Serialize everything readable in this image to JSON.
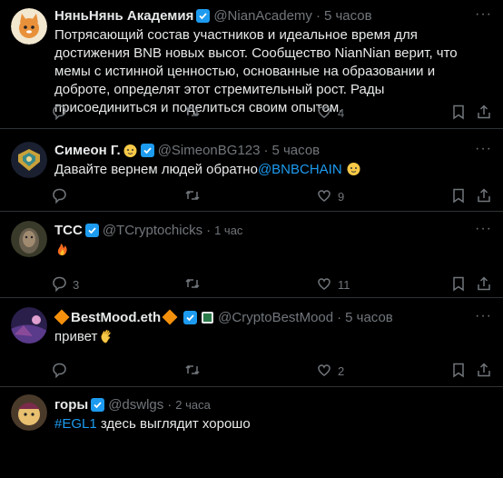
{
  "tweets": [
    {
      "name": "НяньНянь Академия",
      "handle": "@NianAcademy",
      "time": "5 часов",
      "text": "Потрясающий состав участников и идеальное время для достижения BNB новых высот. Сообщество NianNian верит, что мемы с истинной ценностью, основанные на образовании и доброте, определят этот стремительный рост. Рады присоединиться и поделиться своим опытом.",
      "replies": "",
      "retweets": "",
      "likes": "4"
    },
    {
      "name": "Симеон Г.",
      "handle": "@SimeonBG123",
      "time": "5 часов",
      "text_before": "Давайте вернем людей обратно",
      "mention": "@BNBCHAIN",
      "replies": "",
      "retweets": "",
      "likes": "9"
    },
    {
      "name": "TCC",
      "handle": "@TCryptochicks",
      "time": "1 час",
      "replies": "3",
      "retweets": "",
      "likes": "11"
    },
    {
      "name": "BestMood.eth",
      "handle": "@CryptoBestMood",
      "time": "5 часов",
      "text": "привет",
      "replies": "",
      "retweets": "",
      "likes": "2"
    },
    {
      "name": "горы",
      "handle": "@dswlgs",
      "time": "2 часа",
      "hashtag": "#EGL1",
      "text_after": " здесь выглядит хорошо"
    }
  ],
  "icons": {
    "reply": "reply-icon",
    "retweet": "retweet-icon",
    "like": "heart-icon",
    "bookmark": "bookmark-icon",
    "share": "share-icon",
    "more": "more-icon",
    "verified": "verified-badge-icon"
  },
  "colors": {
    "background": "#000000",
    "text": "#e7e9ea",
    "muted": "#71767b",
    "accent": "#1d9bf0",
    "border": "#2f3336"
  }
}
